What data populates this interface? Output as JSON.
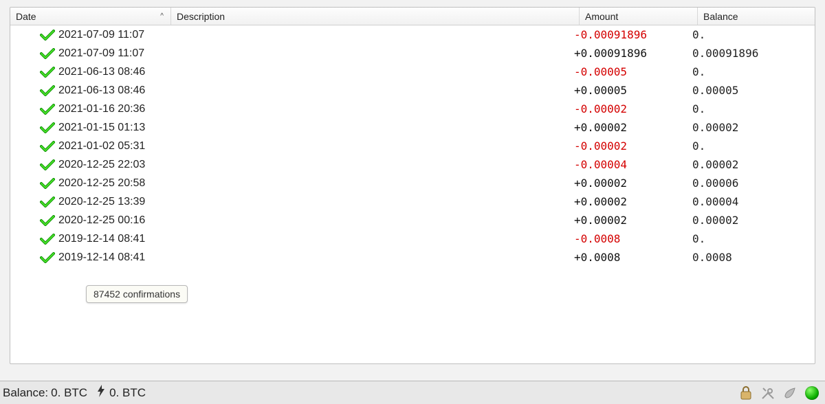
{
  "columns": {
    "date": "Date",
    "description": "Description",
    "amount": "Amount",
    "balance": "Balance",
    "sort_indicator": "^"
  },
  "transactions": [
    {
      "date": "2021-07-09 11:07",
      "desc": "",
      "amount": "-0.00091896",
      "sign": "neg",
      "balance": "0."
    },
    {
      "date": "2021-07-09 11:07",
      "desc": "",
      "amount": "+0.00091896",
      "sign": "pos",
      "balance": "0.00091896"
    },
    {
      "date": "2021-06-13 08:46",
      "desc": "",
      "amount": "-0.00005",
      "sign": "neg",
      "balance": "0."
    },
    {
      "date": "2021-06-13 08:46",
      "desc": "",
      "amount": "+0.00005",
      "sign": "pos",
      "balance": "0.00005"
    },
    {
      "date": "2021-01-16 20:36",
      "desc": "",
      "amount": "-0.00002",
      "sign": "neg",
      "balance": "0."
    },
    {
      "date": "2021-01-15 01:13",
      "desc": "",
      "amount": "+0.00002",
      "sign": "pos",
      "balance": "0.00002"
    },
    {
      "date": "2021-01-02 05:31",
      "desc": "",
      "amount": "-0.00002",
      "sign": "neg",
      "balance": "0."
    },
    {
      "date": "2020-12-25 22:03",
      "desc": "",
      "amount": "-0.00004",
      "sign": "neg",
      "balance": "0.00002"
    },
    {
      "date": "2020-12-25 20:58",
      "desc": "",
      "amount": "+0.00002",
      "sign": "pos",
      "balance": "0.00006"
    },
    {
      "date": "2020-12-25 13:39",
      "desc": "",
      "amount": "+0.00002",
      "sign": "pos",
      "balance": "0.00004"
    },
    {
      "date": "2020-12-25 00:16",
      "desc": "",
      "amount": "+0.00002",
      "sign": "pos",
      "balance": "0.00002"
    },
    {
      "date": "2019-12-14 08:41",
      "desc": "",
      "amount": "-0.0008",
      "sign": "neg",
      "balance": "0."
    },
    {
      "date": "2019-12-14 08:41",
      "desc": "",
      "amount": "+0.0008",
      "sign": "pos",
      "balance": "0.0008"
    }
  ],
  "tooltip": "87452 confirmations",
  "statusbar": {
    "balance_label": "Balance:",
    "balance_value": "0. BTC",
    "lightning_value": "0. BTC"
  },
  "colors": {
    "neg": "#d40000",
    "pos": "#111111"
  }
}
